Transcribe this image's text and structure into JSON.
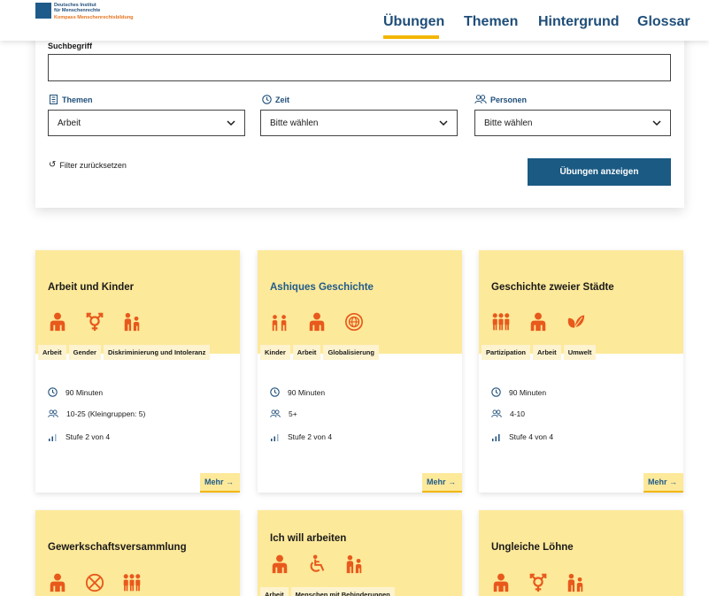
{
  "brand": {
    "line1": "Deutsches Institut",
    "line2": "für Menschenrechte",
    "line3": "Kompass Menschenrechtsbildung"
  },
  "nav": {
    "items": [
      {
        "label": "Übungen",
        "active": true
      },
      {
        "label": "Themen",
        "active": false
      },
      {
        "label": "Hintergrund",
        "active": false
      },
      {
        "label": "Glossar",
        "active": false
      }
    ]
  },
  "filter": {
    "search_label": "Suchbegriff",
    "search_value": "",
    "themen_label": "Themen",
    "themen_value": "Arbeit",
    "zeit_label": "Zeit",
    "zeit_value": "Bitte wählen",
    "personen_label": "Personen",
    "personen_value": "Bitte wählen",
    "reset_label": "Filter zurücksetzen",
    "submit_label": "Übungen anzeigen"
  },
  "cards": [
    {
      "title": "Arbeit und Kinder",
      "tags": [
        "Arbeit",
        "Gender",
        "Diskriminierung und Intoleranz"
      ],
      "duration": "90 Minuten",
      "persons": "10-25 (Kleingruppen: 5)",
      "level": "Stufe 2 von 4",
      "more": "Mehr",
      "icons": [
        "person-icon",
        "gender-icon",
        "family-icon"
      ]
    },
    {
      "title": "Ashiques Geschichte",
      "tags": [
        "Kinder",
        "Arbeit",
        "Globalisierung"
      ],
      "duration": "90 Minuten",
      "persons": "5+",
      "level": "Stufe 2 von 4",
      "more": "Mehr",
      "icons": [
        "children-icon",
        "person-icon",
        "globe-icon"
      ]
    },
    {
      "title": "Geschichte zweier Städte",
      "tags": [
        "Partizipation",
        "Arbeit",
        "Umwelt"
      ],
      "duration": "90 Minuten",
      "persons": "4-10",
      "level": "Stufe 4 von 4",
      "more": "Mehr",
      "icons": [
        "group-icon",
        "person-icon",
        "leaf-icon"
      ]
    },
    {
      "title": "Gewerkschaftsversammlung",
      "icons": [
        "person-icon",
        "prohibited-icon",
        "group-icon"
      ]
    },
    {
      "title": "Ich will arbeiten",
      "tags": [
        "Arbeit",
        "Menschen mit Behinderungen"
      ],
      "icons": [
        "person-icon",
        "wheelchair-icon",
        "family-icon"
      ]
    },
    {
      "title": "Ungleiche Löhne",
      "icons": [
        "person-icon",
        "gender-icon",
        "family-icon"
      ]
    }
  ],
  "colors": {
    "primary": "#1f4e79",
    "button": "#1a5a83",
    "accent": "#f2b600",
    "card_top": "#fde99a",
    "tag_bg": "#fdf3cf",
    "icon": "#e8591c"
  }
}
